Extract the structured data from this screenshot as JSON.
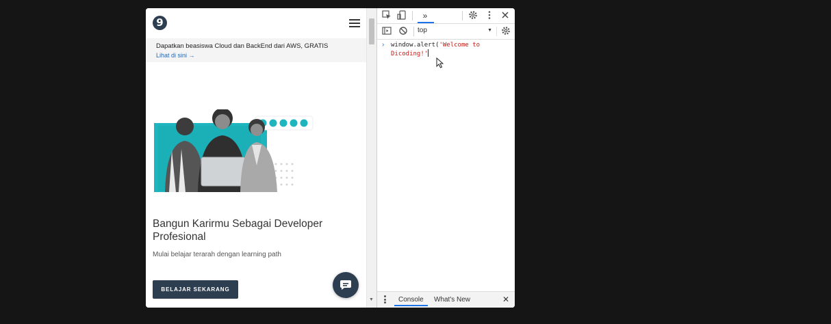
{
  "page": {
    "logo_letter": "9",
    "banner": {
      "text": "Dapatkan beasiswa Cloud dan BackEnd dari AWS, GRATIS",
      "link": "Lihat di sini →"
    },
    "headline": "Bangun Karirmu Sebagai Developer Profesional",
    "subtext": "Mulai belajar terarah dengan learning path",
    "cta_label": "BELAJAR SEKARANG"
  },
  "devtools": {
    "more_tabs": "»",
    "context": "top",
    "console": {
      "code_prefix": "window.alert(",
      "code_string": "'Welcome to Dicoding!'"
    },
    "drawer": {
      "tabs": [
        "Console",
        "What's New"
      ]
    }
  },
  "colors": {
    "brand_dark": "#2d3e50",
    "hero_teal": "#1fb5bf",
    "devtools_accent": "#1a73e8"
  },
  "icons": [
    "logo-icon",
    "hamburger-icon",
    "chat-icon",
    "inspect-element-icon",
    "device-toggle-icon",
    "settings-gear-icon",
    "kebab-menu-icon",
    "close-icon",
    "sidebar-toggle-icon",
    "clear-console-icon",
    "mouse-pointer-icon"
  ]
}
